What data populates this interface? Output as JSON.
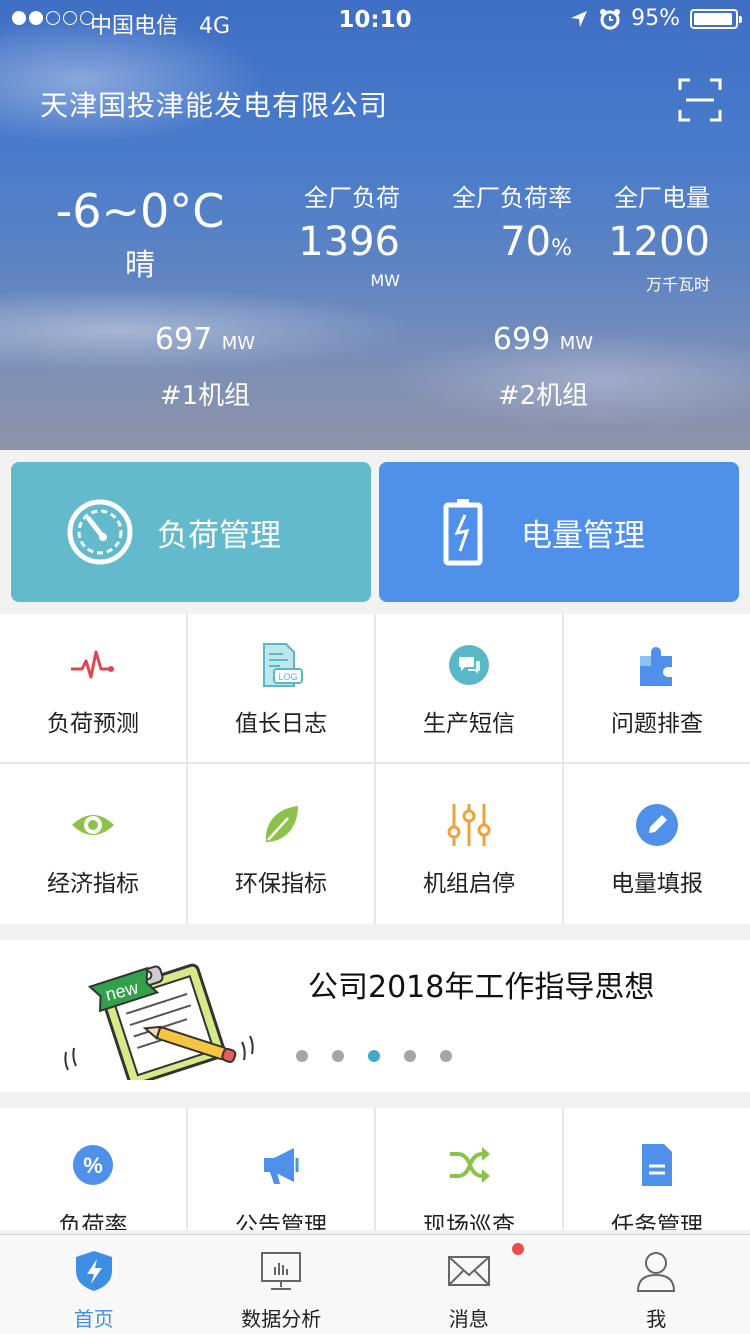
{
  "status_bar": {
    "carrier": "中国电信",
    "network": "4G",
    "time": "10:10",
    "battery_percent": "95%",
    "battery_level": 0.95
  },
  "header": {
    "company": "天津国投津能发电有限公司"
  },
  "weather": {
    "temperature": "-6~0°C",
    "condition": "晴"
  },
  "stats": [
    {
      "label": "全厂负荷",
      "value": "1396",
      "suffix": "",
      "unit": "MW"
    },
    {
      "label": "全厂负荷率",
      "value": "70",
      "suffix": "%",
      "unit": ""
    },
    {
      "label": "全厂电量",
      "value": "1200",
      "suffix": "",
      "unit": "万千瓦时"
    }
  ],
  "units": [
    {
      "value": "697",
      "unit": "MW",
      "name": "#1机组"
    },
    {
      "value": "699",
      "unit": "MW",
      "name": "#2机组"
    }
  ],
  "big_buttons": {
    "load": "负荷管理",
    "power": "电量管理"
  },
  "grid": [
    {
      "label": "负荷预测",
      "icon": "pulse-icon"
    },
    {
      "label": "值长日志",
      "icon": "log-icon"
    },
    {
      "label": "生产短信",
      "icon": "chat-icon"
    },
    {
      "label": "问题排查",
      "icon": "puzzle-icon"
    },
    {
      "label": "经济指标",
      "icon": "eye-icon"
    },
    {
      "label": "环保指标",
      "icon": "leaf-icon"
    },
    {
      "label": "机组启停",
      "icon": "sliders-icon"
    },
    {
      "label": "电量填报",
      "icon": "edit-icon"
    }
  ],
  "banner": {
    "title": "公司2018年工作指导思想",
    "badge_text": "new",
    "active_index": 2,
    "count": 5
  },
  "grid2": [
    {
      "label": "负荷率",
      "icon": "percent-icon"
    },
    {
      "label": "公告管理",
      "icon": "megaphone-icon"
    },
    {
      "label": "现场巡查",
      "icon": "shuffle-icon"
    },
    {
      "label": "任务管理",
      "icon": "document-icon"
    }
  ],
  "tabbar": [
    {
      "label": "首页",
      "icon": "shield-bolt-icon"
    },
    {
      "label": "数据分析",
      "icon": "chart-board-icon"
    },
    {
      "label": "消息",
      "icon": "mail-icon"
    },
    {
      "label": "我",
      "icon": "user-icon"
    }
  ],
  "colors": {
    "accent": "#4f90ea",
    "load_button": "#63bacd",
    "tab_active": "#3d8fe4",
    "badge": "#ee4b4b"
  }
}
